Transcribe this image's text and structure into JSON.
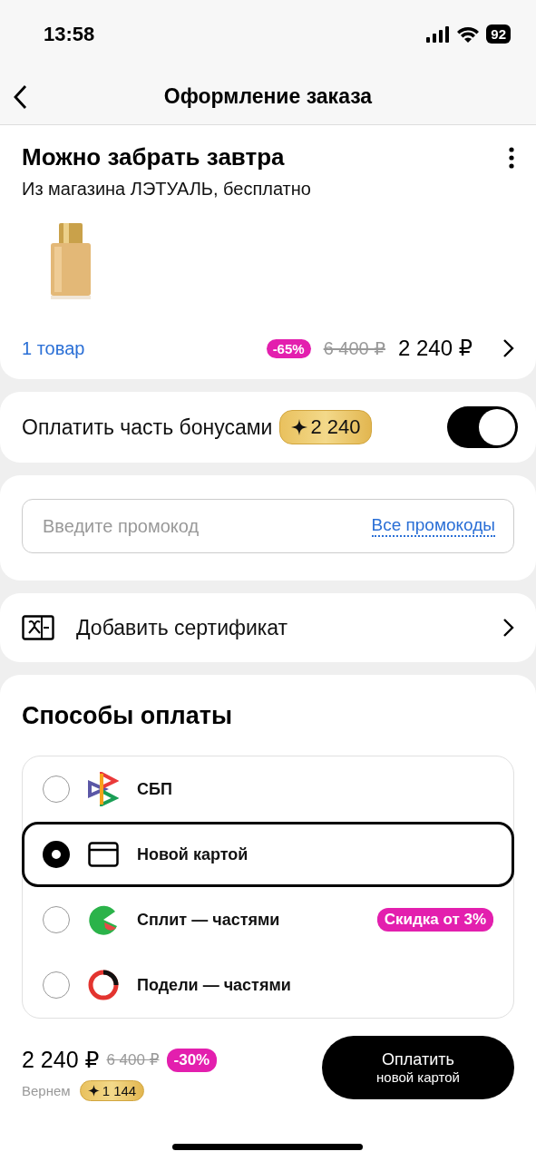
{
  "status_bar": {
    "time": "13:58",
    "battery": "92"
  },
  "header": {
    "title": "Оформление заказа"
  },
  "delivery": {
    "title": "Можно забрать завтра",
    "subtitle": "Из магазина ЛЭТУАЛЬ, бесплатно",
    "items_link": "1 товар",
    "discount": "-65%",
    "old_price": "6 400 ₽",
    "price": "2 240 ₽"
  },
  "bonus": {
    "label": "Оплатить часть бонусами",
    "amount": "2 240",
    "on": true
  },
  "promo": {
    "placeholder": "Введите промокод",
    "link": "Все промокоды"
  },
  "certificate": {
    "label": "Добавить сертификат"
  },
  "payment": {
    "title": "Способы оплаты",
    "methods": [
      {
        "kind": "sbp",
        "label": "СБП",
        "selected": false
      },
      {
        "kind": "card",
        "label": "Новой картой",
        "selected": true
      },
      {
        "kind": "split",
        "label": "Сплит — частями",
        "badge": "Скидка от 3%",
        "selected": false
      },
      {
        "kind": "podeli",
        "label": "Подели — частями",
        "selected": false
      }
    ]
  },
  "footer": {
    "price": "2 240 ₽",
    "old_price": "6 400 ₽",
    "discount": "-30%",
    "cashback_label": "Вернем",
    "cashback": "1 144",
    "button_title": "Оплатить",
    "button_subtitle": "новой картой"
  }
}
